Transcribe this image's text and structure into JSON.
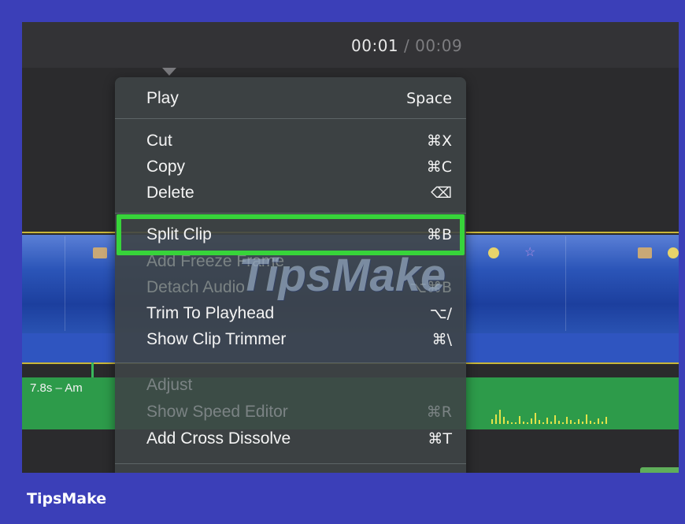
{
  "timecode": {
    "current": "00:01",
    "separator": " / ",
    "total": "00:09"
  },
  "audio_clip_label": "7.8s – Am",
  "menu": {
    "play": {
      "label": "Play",
      "shortcut": "Space"
    },
    "cut": {
      "label": "Cut",
      "shortcut": "⌘X"
    },
    "copy": {
      "label": "Copy",
      "shortcut": "⌘C"
    },
    "delete": {
      "label": "Delete",
      "shortcut": "⌫"
    },
    "split_clip": {
      "label": "Split Clip",
      "shortcut": "⌘B"
    },
    "add_freeze_frame": {
      "label": "Add Freeze Frame",
      "shortcut": ""
    },
    "detach_audio": {
      "label": "Detach Audio",
      "shortcut": "⌥⌘B"
    },
    "trim_to_playhead": {
      "label": "Trim To Playhead",
      "shortcut": "⌥/"
    },
    "show_clip_trimmer": {
      "label": "Show Clip Trimmer",
      "shortcut": "⌘\\"
    },
    "adjust": {
      "label": "Adjust",
      "shortcut": ""
    },
    "show_speed_editor": {
      "label": "Show Speed Editor",
      "shortcut": "⌘R"
    },
    "add_cross_dissolve": {
      "label": "Add Cross Dissolve",
      "shortcut": "⌘T"
    }
  },
  "watermark": "TipsMake",
  "brand": "TipsMake",
  "colors": {
    "page_background": "#3b3fb8",
    "highlight": "#37d43a",
    "video_track": "#2b55b8",
    "audio_track": "#2d9b4a",
    "timeline_line": "#c9b63a"
  }
}
